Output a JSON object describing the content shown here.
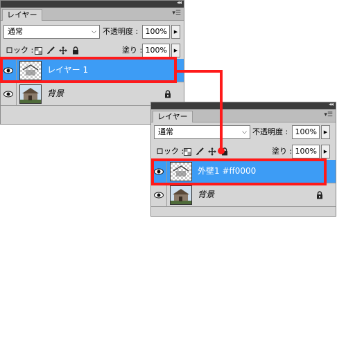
{
  "panel_top": {
    "tab_label": "レイヤー",
    "blend_mode": "通常",
    "opacity_label": "不透明度 :",
    "opacity_value": "100%",
    "lock_label": "ロック :",
    "fill_label": "塗り :",
    "fill_value": "100%",
    "layers": [
      {
        "name": "レイヤー 1",
        "selected": true
      },
      {
        "name": "背景",
        "selected": false
      }
    ]
  },
  "panel_bottom": {
    "tab_label": "レイヤー",
    "blend_mode": "通常",
    "opacity_label": "不透明度 :",
    "opacity_value": "100%",
    "lock_label": "ロック :",
    "fill_label": "塗り :",
    "fill_value": "100%",
    "layers": [
      {
        "name": "外壁1 #ff0000",
        "selected": true
      },
      {
        "name": "背景",
        "selected": false
      }
    ]
  },
  "colors": {
    "highlight": "#ff1a1a",
    "selection": "#3d9cf5",
    "panel_bg": "#d6d6d6"
  },
  "icons": [
    "eye-icon",
    "transparency-lock-icon",
    "brush-lock-icon",
    "move-lock-icon",
    "padlock-icon",
    "collapse-icon",
    "panel-menu-icon",
    "chevron-down-icon",
    "arrow-right-icon"
  ]
}
